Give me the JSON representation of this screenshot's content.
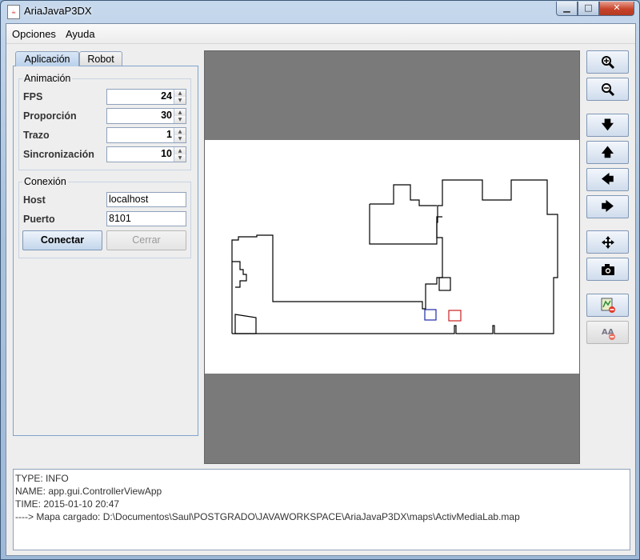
{
  "window": {
    "title": "AriaJavaP3DX",
    "minimize": "▁",
    "maximize": "□",
    "close": "✕"
  },
  "menu": {
    "items": [
      {
        "label": "Opciones"
      },
      {
        "label": "Ayuda"
      }
    ]
  },
  "tabs": [
    {
      "label": "Aplicación",
      "active": true
    },
    {
      "label": "Robot",
      "active": false
    }
  ],
  "animacion": {
    "title": "Animación",
    "fields": [
      {
        "label": "FPS",
        "value": "24"
      },
      {
        "label": "Proporción",
        "value": "30"
      },
      {
        "label": "Trazo",
        "value": "1"
      },
      {
        "label": "Sincronización",
        "value": "10"
      }
    ]
  },
  "conexion": {
    "title": "Conexión",
    "host_label": "Host",
    "host_value": "localhost",
    "port_label": "Puerto",
    "port_value": "8101",
    "connect_label": "Conectar",
    "close_label": "Cerrar"
  },
  "toolbar": {
    "buttons": [
      {
        "icon": "zoom-in-icon",
        "enabled": true
      },
      {
        "icon": "zoom-out-icon",
        "enabled": true
      },
      {
        "icon": "arrow-down-icon",
        "enabled": true
      },
      {
        "icon": "arrow-up-icon",
        "enabled": true
      },
      {
        "icon": "arrow-left-icon",
        "enabled": true
      },
      {
        "icon": "arrow-right-icon",
        "enabled": true
      },
      {
        "icon": "move-icon",
        "enabled": true
      },
      {
        "icon": "camera-icon",
        "enabled": true
      },
      {
        "icon": "map-remove-icon",
        "enabled": true
      },
      {
        "icon": "text-remove-icon",
        "enabled": false
      }
    ]
  },
  "map": {
    "robot_color": "#1f2aa8",
    "goal_color": "#cc2020",
    "background": "#7a7a7a"
  },
  "log": {
    "lines": [
      "TYPE: INFO",
      "NAME: app.gui.ControllerViewApp",
      "TIME: 2015-01-10 20:47",
      "----> Mapa cargado: D:\\Documentos\\Saul\\POSTGRADO\\JAVAWORKSPACE\\AriaJavaP3DX\\maps\\ActivMediaLab.map"
    ]
  }
}
